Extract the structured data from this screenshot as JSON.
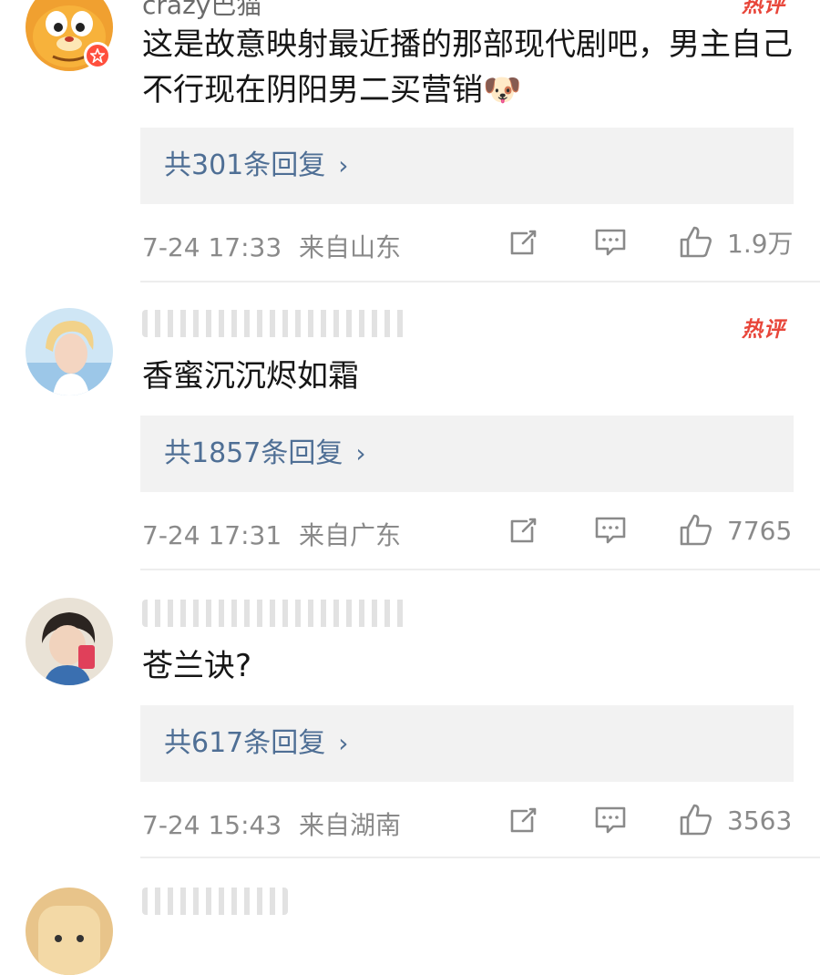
{
  "comments": [
    {
      "username": "crazy巴猫",
      "hot_tag": "热评",
      "text": "这是故意映射最近播的那部现代剧吧，男主自己不行现在阴阳男二买营销🐶",
      "reply_label": "共301条回复",
      "time": "7-24 17:33",
      "location": "来自山东",
      "likes": "1.9万"
    },
    {
      "username": "",
      "hot_tag": "热评",
      "text": "香蜜沉沉烬如霜",
      "reply_label": "共1857条回复",
      "time": "7-24 17:31",
      "location": "来自广东",
      "likes": "7765"
    },
    {
      "username": "",
      "text": "苍兰诀?",
      "reply_label": "共617条回复",
      "time": "7-24 15:43",
      "location": "来自湖南",
      "likes": "3563"
    },
    {
      "username": "",
      "text": ""
    }
  ],
  "icons": {
    "share": "share-icon",
    "comment": "comment-icon",
    "like": "like-icon",
    "chevron": "chevron-right-icon"
  },
  "colors": {
    "link": "#4f6f95",
    "hot": "#e8463a",
    "badge": "#ff4f3d"
  }
}
